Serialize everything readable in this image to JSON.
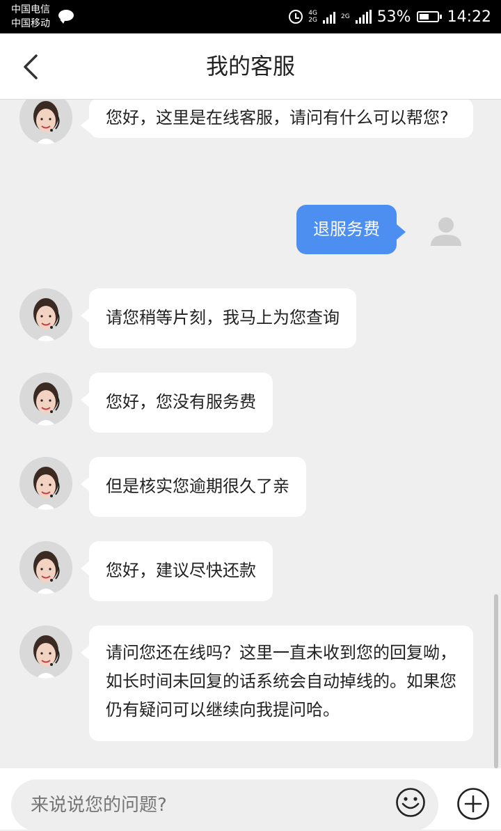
{
  "status_bar": {
    "carrier_1": "中国电信",
    "carrier_2": "中国移动",
    "net_top": "4G",
    "net_bottom": "2G",
    "net2": "2G",
    "battery_percent": "53%",
    "battery_level": 0.53,
    "time": "14:22"
  },
  "header": {
    "title": "我的客服"
  },
  "messages": [
    {
      "from": "agent",
      "text": "您好，这里是在线客服，请问有什么可以帮您?"
    },
    {
      "from": "user",
      "text": "退服务费"
    },
    {
      "from": "agent",
      "text": "请您稍等片刻，我马上为您查询"
    },
    {
      "from": "agent",
      "text": "您好，您没有服务费"
    },
    {
      "from": "agent",
      "text": "但是核实您逾期很久了亲"
    },
    {
      "from": "agent",
      "text": "您好，建议尽快还款"
    },
    {
      "from": "agent",
      "text": "请问您还在线吗？这里一直未收到您的回复呦，如长时间未回复的话系统会自动掉线的。如果您仍有疑问可以继续向我提问哈。"
    }
  ],
  "input": {
    "placeholder": "来说说您的问题?"
  },
  "colors": {
    "user_bubble": "#4c8ff0",
    "background": "#efefef"
  },
  "icons": {
    "back": "back-arrow-icon",
    "emoji": "smiley-icon",
    "plus": "plus-circle-icon"
  }
}
